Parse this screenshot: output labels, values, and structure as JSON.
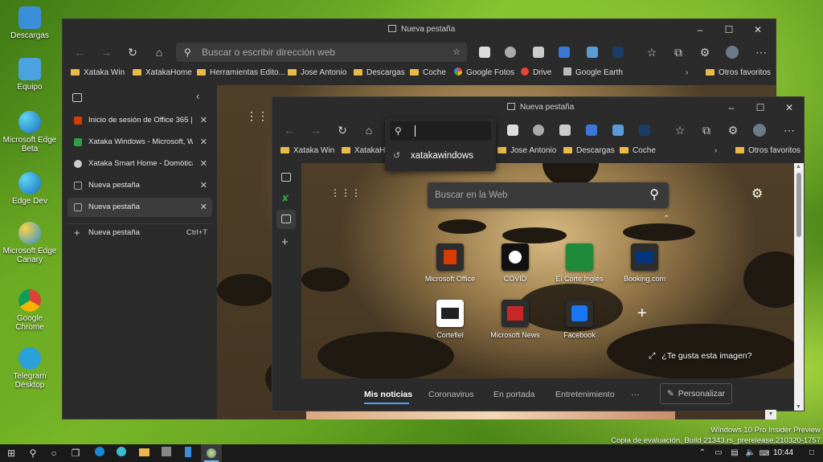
{
  "desktop": {
    "icons": [
      {
        "label": "Descargas"
      },
      {
        "label": "Equipo"
      },
      {
        "label": "Microsoft Edge Beta"
      },
      {
        "label": "Edge Dev"
      },
      {
        "label": "Microsoft Edge Canary"
      },
      {
        "label": "Google Chrome"
      },
      {
        "label": "Telegram Desktop"
      }
    ],
    "watermark_line1": "Windows 10 Pro Insider Preview",
    "watermark_line2": "Copia de evaluación. Build 21343.rs_prerelease.210320-1757"
  },
  "back_window": {
    "title": "Nueva pestaña",
    "address_placeholder": "Buscar o escribir dirección web",
    "favorites": [
      "Xataka Win",
      "XatakaHome",
      "Herramientas Edito...",
      "Jose Antonio",
      "Descargas",
      "Coche",
      "Google Fotos",
      "Drive",
      "Google Earth"
    ],
    "other_favorites": "Otros favoritos",
    "vertical_tabs": [
      {
        "label": "Inicio de sesión de Office 365 | M",
        "color": "#d83b01"
      },
      {
        "label": "Xataka Windows - Microsoft, Win",
        "color": "#2ea043"
      },
      {
        "label": "Xataka Smart Home - Domótica,",
        "color": "#cccccc"
      },
      {
        "label": "Nueva pestaña",
        "color": "#999999"
      },
      {
        "label": "Nueva pestaña",
        "color": "#999999"
      }
    ],
    "new_tab_label": "Nueva pestaña",
    "new_tab_shortcut": "Ctrl+T"
  },
  "front_window": {
    "title": "Nueva pestaña",
    "address_value": "",
    "suggestion": "xatakawindows",
    "favorites": [
      "Xataka Win",
      "XatakaHo",
      "Jose Antonio",
      "Descargas",
      "Coche"
    ],
    "other_favorites": "Otros favoritos",
    "search_placeholder": "Buscar en la Web",
    "tiles": [
      {
        "label": "Microsoft Office",
        "color": "#d83b01"
      },
      {
        "label": "COVID",
        "color": "#111111"
      },
      {
        "label": "El Corte Inglés",
        "color": "#1e8a3a"
      },
      {
        "label": "Booking.com",
        "color": "#003580"
      },
      {
        "label": "Cortefiel",
        "color": "#222222"
      },
      {
        "label": "Microsoft News",
        "color": "#c62828"
      },
      {
        "label": "Facebook",
        "color": "#1877f2"
      }
    ],
    "image_like": "¿Te gusta esta imagen?",
    "news_tabs": [
      "Mis noticias",
      "Coronavirus",
      "En portada",
      "Entretenimiento",
      "···"
    ],
    "personalize": "Personalizar"
  },
  "taskbar": {
    "time": "10:44"
  }
}
